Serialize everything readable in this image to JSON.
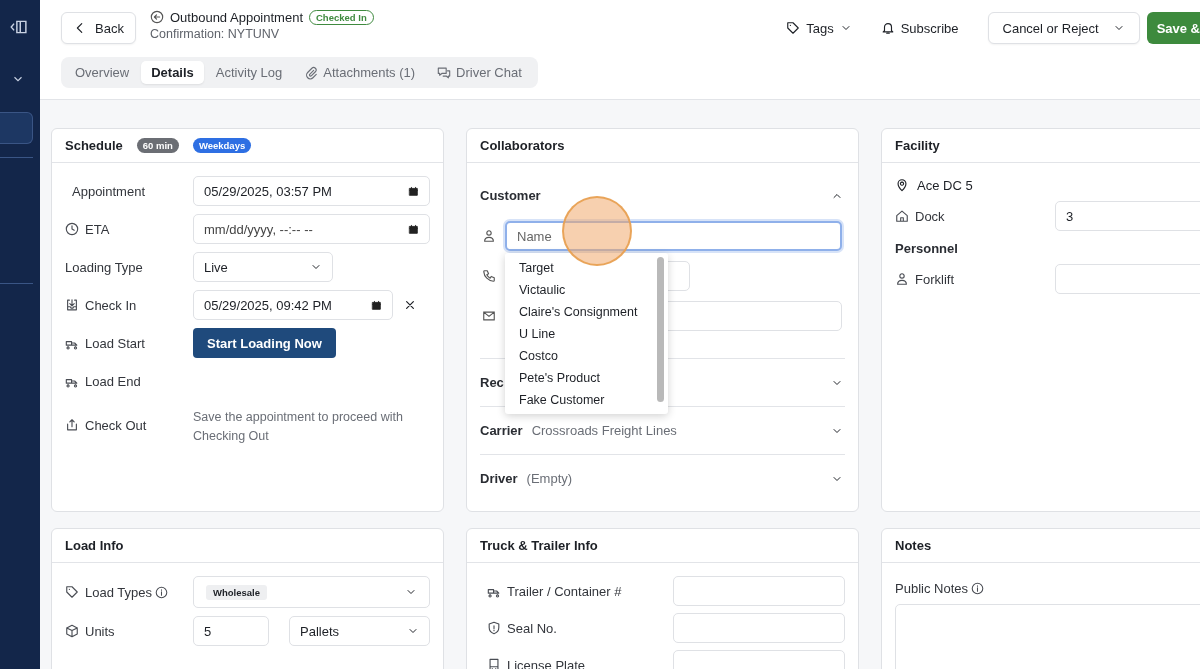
{
  "header": {
    "back": "Back",
    "title": "Outbound Appointment",
    "status": "Checked In",
    "confirmation": "Confirmation: NYTUNV",
    "actions": [
      {
        "kind": "menu",
        "label": "Tags"
      },
      {
        "kind": "link",
        "label": "Subscribe"
      },
      {
        "kind": "dropdown",
        "label": "Cancel or Reject"
      },
      {
        "kind": "primary",
        "label": "Save &"
      }
    ]
  },
  "tabs": [
    {
      "label": "Overview",
      "selected": false
    },
    {
      "label": "Details",
      "selected": true
    },
    {
      "label": "Activity Log",
      "selected": false
    },
    {
      "label": "Attachments (1)",
      "selected": false
    },
    {
      "label": "Driver Chat",
      "selected": false
    }
  ],
  "schedule": {
    "title": "Schedule",
    "badges": [
      {
        "label": "60 min",
        "color": "#6b6e74"
      },
      {
        "label": "Weekdays",
        "color": "#2e6fe3"
      }
    ],
    "rows": [
      {
        "label": "Appointment",
        "kind": "datetime",
        "value": "05/29/2025, 03:57 PM",
        "clearable": false
      },
      {
        "label": "ETA",
        "kind": "datetime",
        "placeholder": "mm/dd/yyyy, --:-- --",
        "clearable": false
      },
      {
        "label": "Loading Type",
        "kind": "select",
        "value": "Live"
      },
      {
        "label": "Check In",
        "kind": "datetime",
        "value": "05/29/2025, 09:42 PM",
        "clearable": true
      },
      {
        "label": "Load Start",
        "kind": "button",
        "value": "Start Loading Now"
      },
      {
        "label": "Load End",
        "kind": "empty"
      },
      {
        "label": "Check Out",
        "kind": "note",
        "value": "Save the appointment to proceed with Checking Out"
      }
    ]
  },
  "collaborators": {
    "title": "Collaborators",
    "sections": [
      {
        "label": "Customer",
        "expanded": true,
        "fields": [
          {
            "kind": "name",
            "placeholder": "Name",
            "focused": true
          },
          {
            "kind": "phone",
            "focused": false
          },
          {
            "kind": "email",
            "focused": false
          }
        ],
        "suggestions": [
          "Target",
          "Victaulic",
          "Claire's Consignment",
          "U Line",
          "Costco",
          "Pete's Product",
          "Fake Customer"
        ]
      },
      {
        "label": "Rec",
        "expanded": false
      },
      {
        "label": "Carrier",
        "value": "Crossroads Freight Lines",
        "expanded": false
      },
      {
        "label": "Driver",
        "value": "(Empty)",
        "expanded": false
      }
    ]
  },
  "facility": {
    "title": "Facility",
    "location": "Ace DC 5",
    "dock": {
      "label": "Dock",
      "value": "3"
    },
    "personnel_title": "Personnel",
    "forklift": {
      "label": "Forklift"
    }
  },
  "load_info": {
    "title": "Load Info",
    "load_types": {
      "label": "Load Types",
      "tags": [
        "Wholesale"
      ]
    },
    "units": {
      "label": "Units",
      "value": "5",
      "unit": "Pallets"
    }
  },
  "truck_trailer": {
    "title": "Truck & Trailer Info",
    "fields": [
      {
        "label": "Trailer / Container #"
      },
      {
        "label": "Seal No."
      },
      {
        "label": "License Plate"
      }
    ]
  },
  "notes": {
    "title": "Notes",
    "public_notes": {
      "label": "Public Notes"
    }
  }
}
